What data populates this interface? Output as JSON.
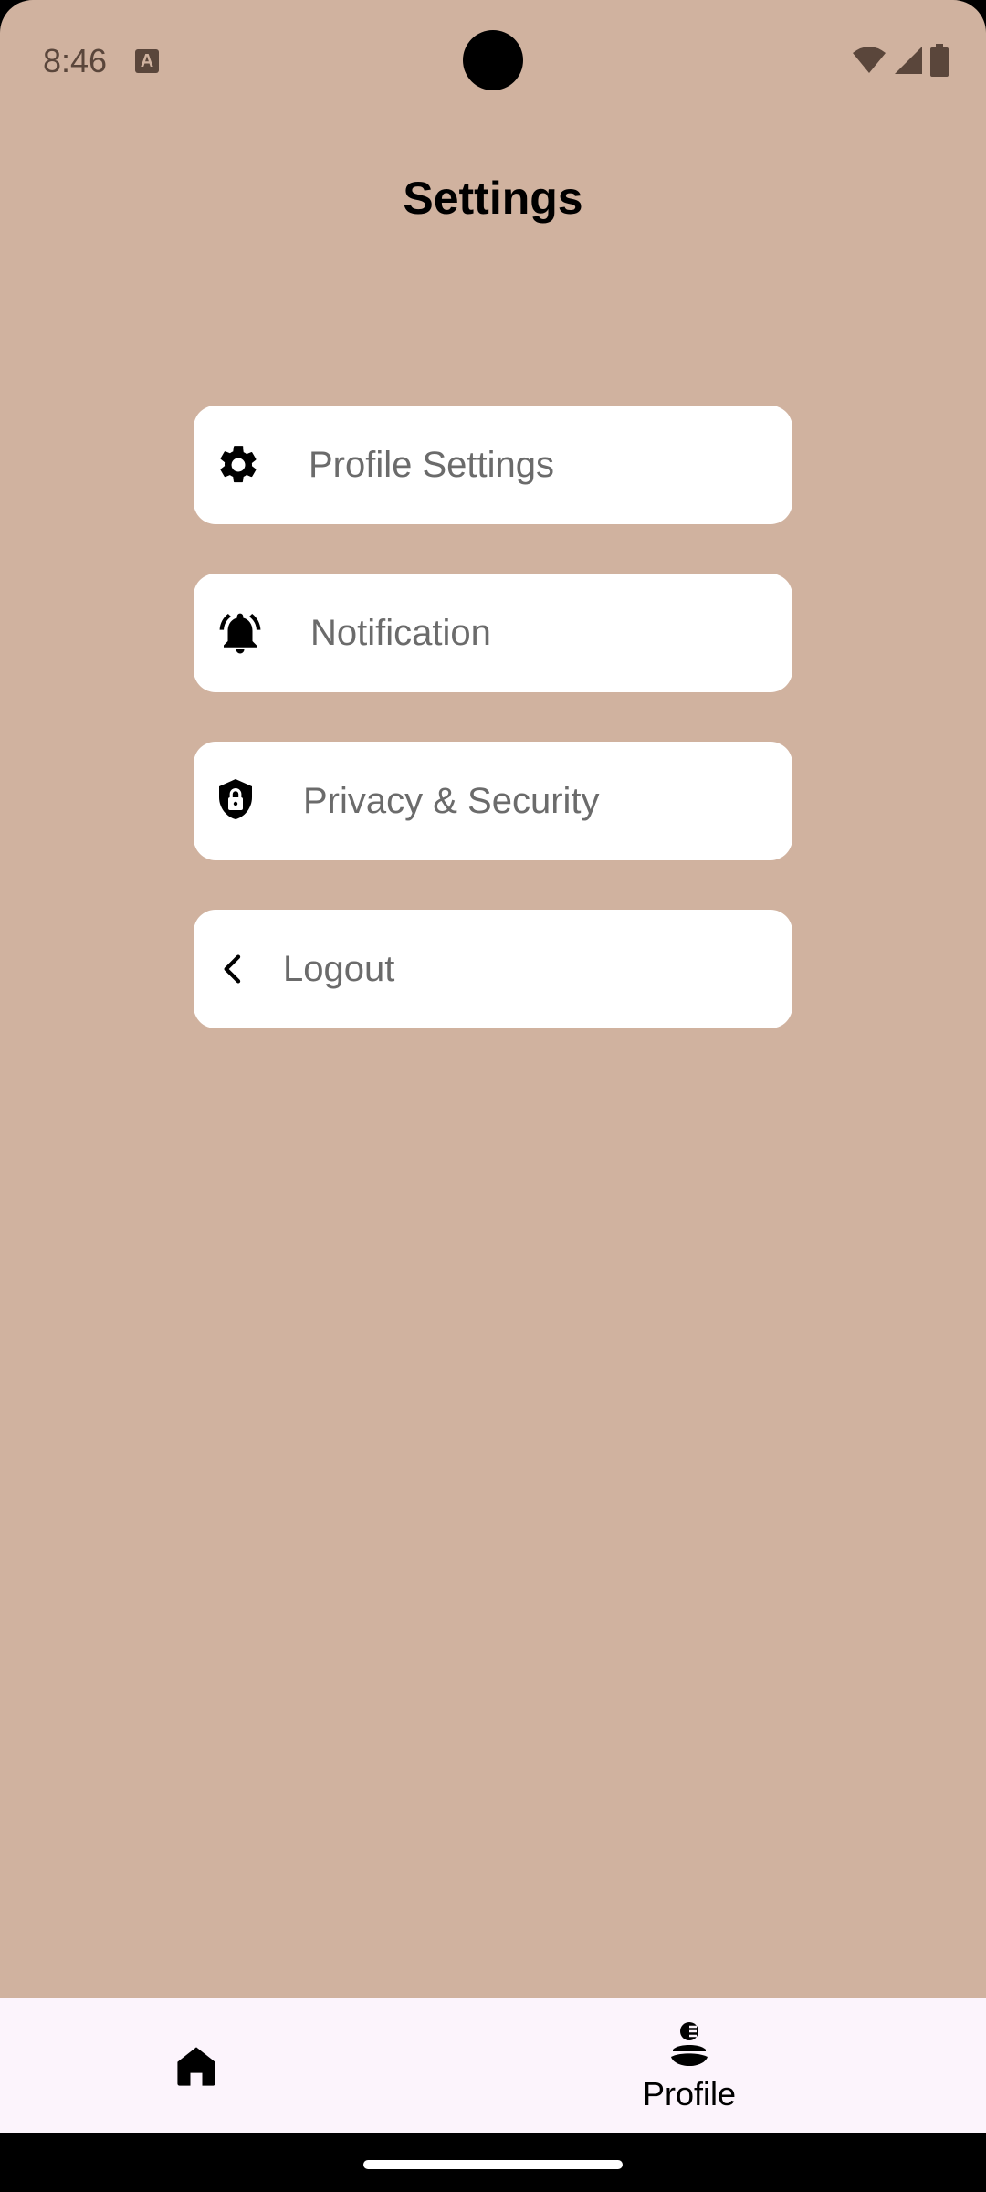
{
  "status_bar": {
    "time": "8:46",
    "notification_icon": "a-icon",
    "icons": [
      "wifi-icon",
      "signal-icon",
      "battery-icon"
    ]
  },
  "header": {
    "title": "Settings"
  },
  "menu": {
    "items": [
      {
        "label": "Profile Settings",
        "icon": "gear-icon"
      },
      {
        "label": "Notification",
        "icon": "bell-icon"
      },
      {
        "label": "Privacy & Security",
        "icon": "shield-lock-icon"
      },
      {
        "label": "Logout",
        "icon": "chevron-left-icon"
      }
    ]
  },
  "bottom_nav": {
    "home": {
      "icon": "home-icon"
    },
    "profile": {
      "label": "Profile",
      "icon": "profile-icon"
    }
  },
  "colors": {
    "background": "#d0b29f",
    "card": "#ffffff",
    "card_text": "#6b6b6b",
    "nav_background": "#fcf4fc"
  }
}
